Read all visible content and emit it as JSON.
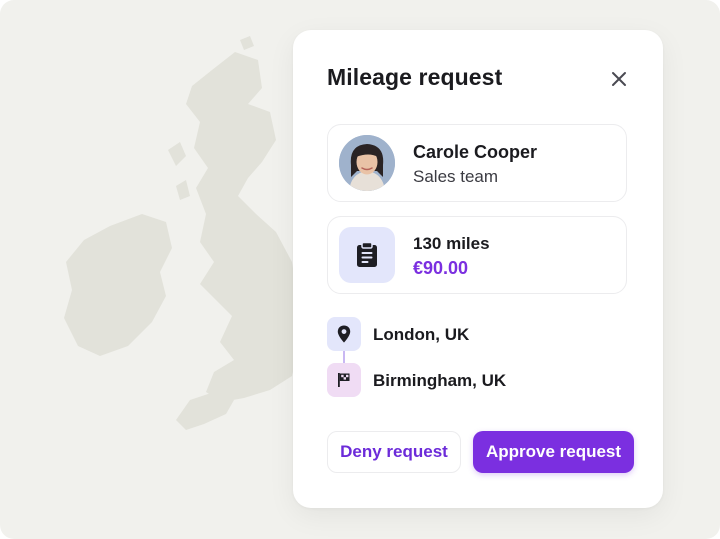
{
  "dialog": {
    "title": "Mileage request",
    "close_icon": "close-icon"
  },
  "requester": {
    "name": "Carole Cooper",
    "team": "Sales team",
    "avatar": "avatar-photo"
  },
  "trip": {
    "icon": "clipboard-icon",
    "distance": "130 miles",
    "amount": "€90.00"
  },
  "route": {
    "from": {
      "label": "London, UK",
      "icon": "map-pin-icon"
    },
    "to": {
      "label": "Birmingham, UK",
      "icon": "finish-flag-icon"
    }
  },
  "actions": {
    "deny_label": "Deny request",
    "approve_label": "Approve request"
  },
  "colors": {
    "accent": "#7b2fe0",
    "background": "#f1f1ed",
    "map": "#e3e3dc"
  }
}
